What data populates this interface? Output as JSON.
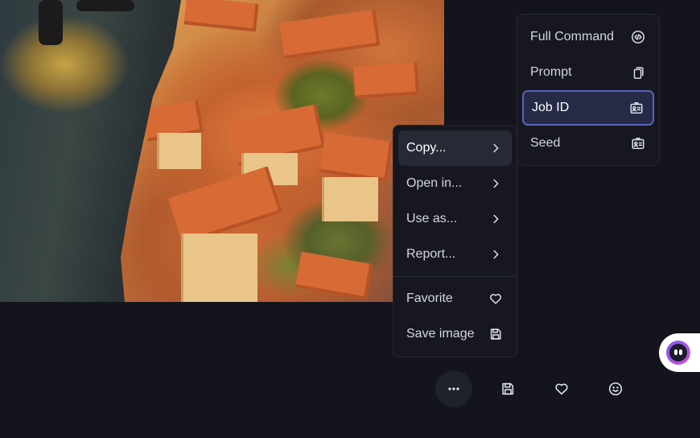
{
  "copy_submenu": {
    "items": [
      {
        "label": "Full Command",
        "icon": "code-icon"
      },
      {
        "label": "Prompt",
        "icon": "copy-icon"
      },
      {
        "label": "Job ID",
        "icon": "id-card-icon"
      },
      {
        "label": "Seed",
        "icon": "id-card-icon"
      }
    ]
  },
  "context_menu": {
    "items": [
      {
        "label": "Copy...",
        "icon": "chevron-right-icon"
      },
      {
        "label": "Open in...",
        "icon": "chevron-right-icon"
      },
      {
        "label": "Use as...",
        "icon": "chevron-right-icon"
      },
      {
        "label": "Report...",
        "icon": "chevron-right-icon"
      }
    ],
    "actions": [
      {
        "label": "Favorite",
        "icon": "heart-icon"
      },
      {
        "label": "Save image",
        "icon": "save-icon"
      }
    ]
  },
  "toolbar": {
    "buttons": [
      {
        "name": "more-options",
        "icon": "ellipsis-icon"
      },
      {
        "name": "save",
        "icon": "save-icon"
      },
      {
        "name": "favorite",
        "icon": "heart-icon"
      },
      {
        "name": "react",
        "icon": "smile-icon"
      }
    ]
  },
  "colors": {
    "background": "#13141c",
    "menu": "#17181f",
    "hover": "#272a36",
    "selected_border": "#5a63b8"
  }
}
